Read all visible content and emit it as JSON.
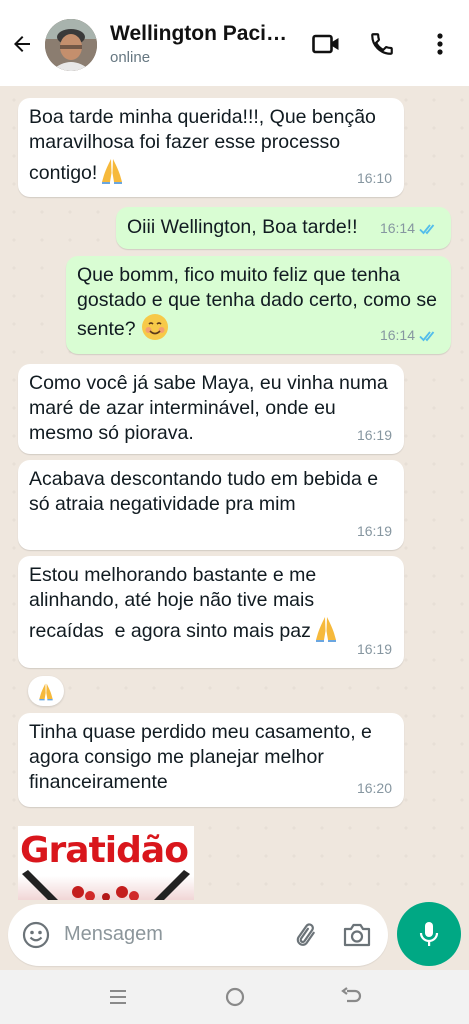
{
  "header": {
    "contact_name": "Wellington Paci…",
    "status": "online"
  },
  "messages": [
    {
      "direction": "in",
      "text": "Boa tarde minha querida!!!, Que benção maravilhosa foi fazer esse processo contigo!",
      "emoji": "folded-hands",
      "time": "16:10"
    },
    {
      "direction": "out",
      "text": "Oiii Wellington, Boa tarde!!",
      "time": "16:14",
      "read": true
    },
    {
      "direction": "out",
      "text": "Que bomm, fico muito feliz que tenha gostado e que tenha dado certo, como se sente?",
      "emoji": "smiling-face",
      "time": "16:14",
      "read": true
    },
    {
      "direction": "in",
      "text": "Como você já sabe Maya, eu vinha numa maré de azar interminável, onde eu mesmo só piorava.",
      "time": "16:19"
    },
    {
      "direction": "in",
      "text": "Acabava descontando tudo em bebida e só atraia negatividade pra mim",
      "time": "16:19"
    },
    {
      "direction": "in",
      "text": "Estou melhorando bastante e me alinhando, até hoje não tive mais recaídas  e agora sinto mais paz",
      "emoji": "folded-hands",
      "time": "16:19",
      "reaction": "folded-hands"
    },
    {
      "direction": "in",
      "text": "Tinha quase perdido meu casamento, e agora consigo me planejar melhor financeiramente",
      "time": "16:20"
    }
  ],
  "image_message": {
    "text": "Gratidão"
  },
  "composer": {
    "placeholder": "Mensagem"
  },
  "colors": {
    "accent": "#00a884",
    "outgoing_bubble": "#d9fdd3",
    "incoming_bubble": "#ffffff",
    "read_ticks": "#53bdeb"
  },
  "icons": [
    "back-arrow-icon",
    "video-call-icon",
    "phone-icon",
    "more-options-icon",
    "emoji-icon",
    "attach-icon",
    "camera-icon",
    "microphone-icon",
    "recents-icon",
    "home-icon",
    "back-icon"
  ]
}
